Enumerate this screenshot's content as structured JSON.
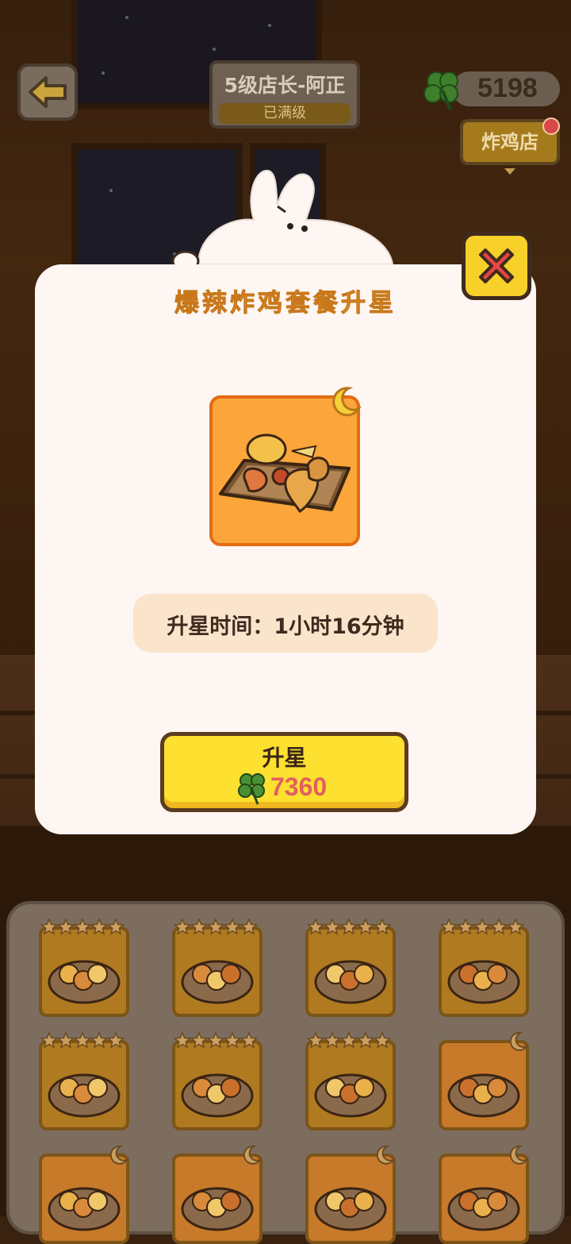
{
  "header": {
    "level_title": "5级店长-阿正",
    "level_status": "已满级",
    "clover_count": "5198",
    "shop_button": "炸鸡店"
  },
  "dialog": {
    "title": "爆辣炸鸡套餐升星",
    "upgrade_time": "升星时间：1小时16分钟",
    "upgrade_button_label": "升星",
    "upgrade_cost": "7360"
  },
  "recipes": [
    {
      "badge": "stars",
      "dish": "fried-chicken-tray"
    },
    {
      "badge": "stars",
      "dish": "chicken-bucket"
    },
    {
      "badge": "stars",
      "dish": "chicken-nachos"
    },
    {
      "badge": "stars",
      "dish": "chicken-burger"
    },
    {
      "badge": "stars",
      "dish": "chicken-nuggets-board"
    },
    {
      "badge": "stars",
      "dish": "chicken-rings-plate"
    },
    {
      "badge": "stars",
      "dish": "chicken-strips"
    },
    {
      "badge": "moon",
      "dish": "spicy-wings"
    },
    {
      "badge": "moon",
      "dish": "chicken-popcorn"
    },
    {
      "badge": "moon",
      "dish": "fries-box"
    },
    {
      "badge": "moon",
      "dish": "drumsticks-plate"
    },
    {
      "badge": "moon",
      "dish": "salad-chicken"
    }
  ],
  "colors": {
    "accent_yellow": "#fde030",
    "cost_red": "#e25f5f",
    "title_orange": "#f5b74a",
    "item_frame": "#fba53a",
    "close_red": "#e64646"
  }
}
